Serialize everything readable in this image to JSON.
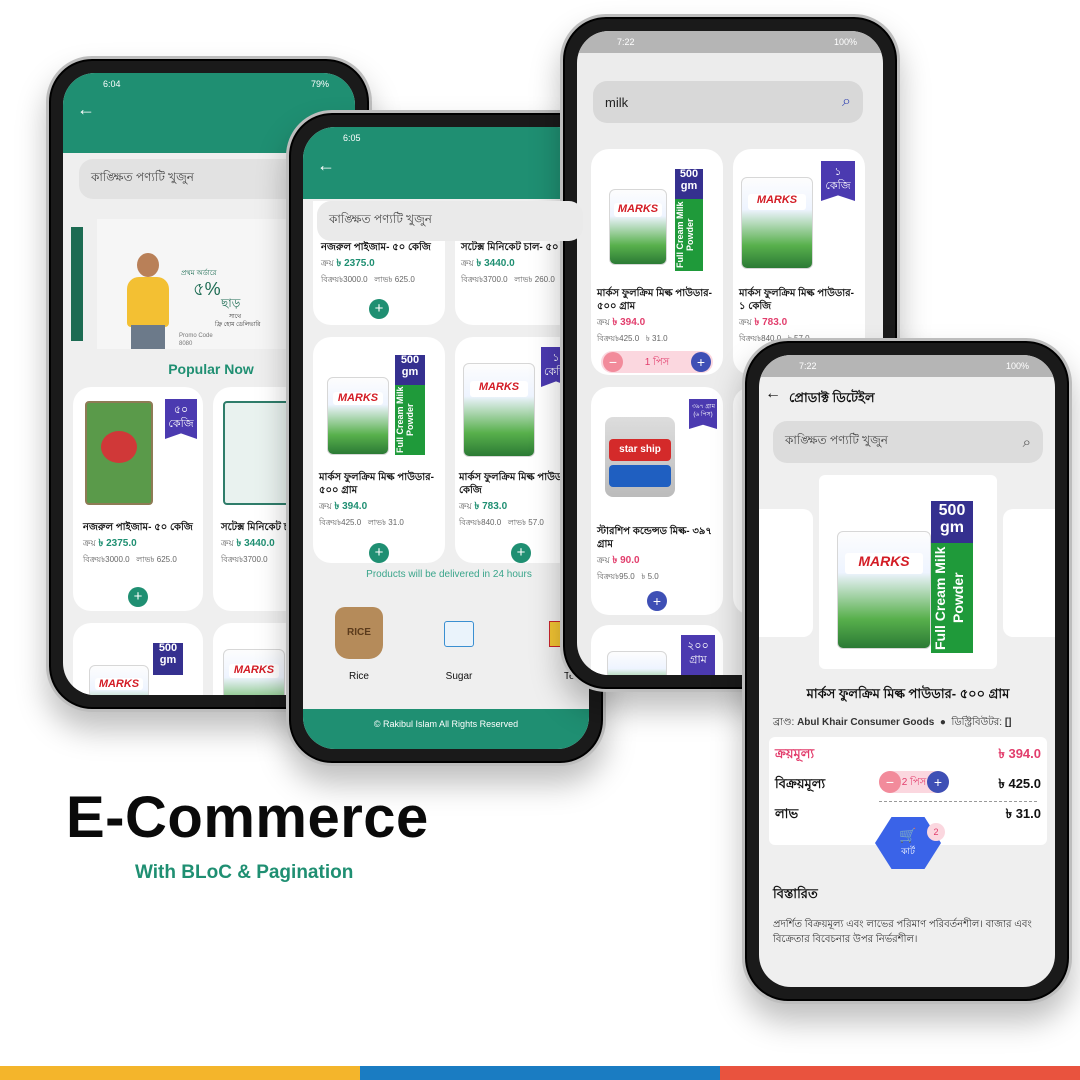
{
  "brand": {
    "title": "E-Commerce",
    "subtitle": "With BLoC & Pagination",
    "accent": "#1f8f72"
  },
  "colors": {
    "teal": "#1f8f72",
    "purple": "#4b3ab0",
    "pink": "#e23d6c",
    "blue": "#3e4fb5",
    "bar_yellow": "#f4b52b",
    "bar_blue": "#1a7cc2",
    "bar_red": "#e9533e"
  },
  "phone1": {
    "time": "6:04",
    "battery": "79%",
    "back_icon": "arrow-left-icon",
    "search_placeholder": "কাঙ্ক্ষিত পণ্যটি খুজুন",
    "banner": {
      "line1": "প্রথম অর্ডারে",
      "percent": "৫%",
      "line2": "ছাড়",
      "line3": "সাথে",
      "line4": "ফ্রি হোম ডেলিভারি",
      "promo": "Promo Code",
      "code": "8080"
    },
    "section_title": "Popular Now",
    "products": [
      {
        "badge": "৫০\nকেজি",
        "name": "নজরুল পাইজাম- ৫০ কেজি",
        "buy_label": "ক্রয়",
        "buy": "৳ 2375.0",
        "sell_label": "বিক্রয়",
        "sell": "৳3000.0",
        "profit_label": "লাভ",
        "profit": "৳ 625.0"
      },
      {
        "name": "সটেক্স মিনিকেট চাল- কেজি",
        "buy_label": "ক্রয়",
        "buy": "৳ 3440.0",
        "sell_label": "বিক্রয়",
        "sell": "৳3700.0"
      }
    ],
    "row2_badge": "500\ngm"
  },
  "phone2": {
    "time": "6:05",
    "search_placeholder": "কাঙ্ক্ষিত পণ্যটি খুজুন",
    "top_products": [
      {
        "name": "নজরুল পাইজাম- ৫০ কেজি",
        "buy_label": "ক্রয়",
        "buy": "৳ 2375.0",
        "sell_label": "বিক্রয়",
        "sell": "৳3000.0",
        "profit_label": "লাভ",
        "profit": "৳ 625.0"
      },
      {
        "name": "সটেক্স মিনিকেট চাল- ৫০ কেজি",
        "buy_label": "ক্রয়",
        "buy": "৳ 3440.0",
        "sell_label": "বিক্রয়",
        "sell": "৳3700.0",
        "profit_label": "লাভ",
        "profit": "৳ 260.0"
      }
    ],
    "products": [
      {
        "badge_num": "500",
        "badge_unit": "gm",
        "name": "মার্কস ফুলক্রিম মিল্ক পাউডার- ৫০০ গ্রাম",
        "buy_label": "ক্রয়",
        "buy": "৳ 394.0",
        "sell_label": "বিক্রয়",
        "sell": "৳425.0",
        "profit_label": "লাভ",
        "profit": "৳ 31.0"
      },
      {
        "badge": "১\nকেজি",
        "name": "মার্কস ফুলক্রিম মিল্ক পাউডার- ১ কেজি",
        "buy_label": "ক্রয়",
        "buy": "৳ 783.0",
        "sell_label": "বিক্রয়",
        "sell": "৳840.0",
        "profit_label": "লাভ",
        "profit": "৳ 57.0"
      }
    ],
    "delivery_note": "Products will be delivered in 24 hours",
    "categories": [
      {
        "label": "Rice",
        "icon": "rice-sack-icon"
      },
      {
        "label": "Sugar",
        "icon": "sugar-pack-icon"
      },
      {
        "label": "Tea",
        "icon": "tea-box-icon"
      }
    ],
    "footer": "© Rakibul Islam All Rights Reserved"
  },
  "phone3": {
    "time": "7:22",
    "battery": "100%",
    "search_value": "milk",
    "products": [
      {
        "badge_num": "500",
        "badge_unit": "gm",
        "name": "মার্কস ফুলক্রিম মিল্ক পাউডার- ৫০০ গ্রাম",
        "buy_label": "ক্রয়",
        "buy": "৳ 394.0",
        "sell_label": "বিক্রয়",
        "sell": "৳425.0",
        "profit": "৳ 31.0",
        "qty": "1 পিস"
      },
      {
        "badge": "১\nকেজি",
        "name": "মার্কস ফুলক্রিম মিল্ক পাউডার- ১ কেজি",
        "buy_label": "ক্রয়",
        "buy": "৳ 783.0",
        "sell_label": "বিক্রয়",
        "sell": "৳840.0",
        "profit": "৳ 57.0"
      },
      {
        "badge": "৩৯৭ গ্রাম\n(৬ পিস)",
        "name": "স্টারশিপ কন্ডেন্সড মিল্ক- ৩৯৭ গ্রাম",
        "buy_label": "ক্রয়",
        "buy": "৳ 90.0",
        "sell_label": "বিক্রয়",
        "sell": "৳95.0",
        "profit": "৳ 5.0"
      },
      {
        "badge": "২০০\nগ্রাম"
      }
    ],
    "tin_label": "star ship"
  },
  "phone4": {
    "time": "7:22",
    "battery": "100%",
    "title": "প্রোডাক্ট ডিটেইল",
    "search_placeholder": "কাঙ্ক্ষিত পণ্যটি খুজুন",
    "badge_num": "500",
    "badge_unit": "gm",
    "strip": "Full Cream Milk Powder",
    "bag_logo": "MARKS",
    "product_name": "মার্কস ফুলক্রিম মিল্ক পাউডার- ৫০০ গ্রাম",
    "brand_label": "ব্রাণ্ড:",
    "brand": "Abul Khair Consumer Goods",
    "dist_label": "ডিস্ট্রিবিউটর:",
    "dist": "[]",
    "buy_label": "ক্রয়মূল্য",
    "buy": "৳ 394.0",
    "sell_label": "বিক্রয়মূল্য",
    "qty": "2 পিস",
    "sell": "৳ 425.0",
    "profit_label": "লাভ",
    "profit": "৳ 31.0",
    "cart_label": "কার্ট",
    "cart_count": "2",
    "details_title": "বিস্তারিত",
    "details_text": "প্রদর্শিত বিক্রয়মূল্য এবং লাভের পরিমাণ পরিবর্তনশীল। বাজার এবং বিক্রেতার বিবেচনার উপর নির্ভরশীল।"
  }
}
